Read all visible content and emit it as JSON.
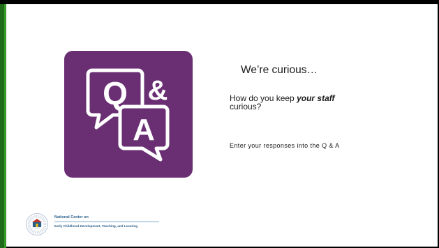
{
  "slide": {
    "heading": "We’re curious…",
    "question_prefix": "How do you keep ",
    "question_emphasis": "your staff",
    "question_suffix": "curious?",
    "instruction": "Enter your responses into the Q & A",
    "icon": {
      "name": "q-and-a-speech-bubbles-icon",
      "letter_q": "Q",
      "letter_amp": "&",
      "letter_a": "A"
    },
    "colors": {
      "tile": "#6a2f73",
      "accent_green": "#3a9a2b",
      "logo_blue": "#2a5f8a"
    }
  },
  "footer": {
    "logo_line1": "National Center on",
    "logo_line2": "Early Childhood Development, Teaching, and Learning"
  }
}
